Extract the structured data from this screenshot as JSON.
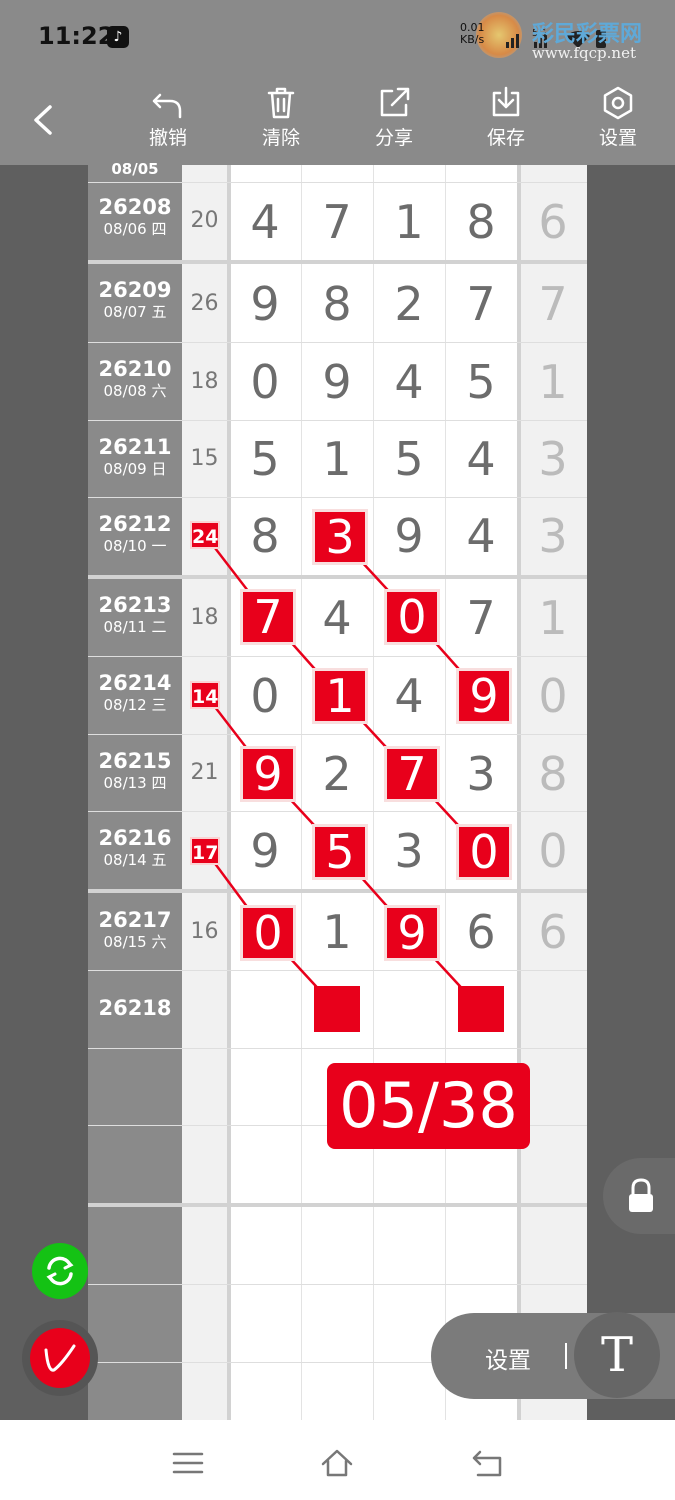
{
  "status": {
    "time": "11:22",
    "net_speed": "0.01",
    "net_unit": "KB/s",
    "sig1": "5G",
    "sig2": "5G"
  },
  "watermark": {
    "brand": "彩民彩票网",
    "url": "www.fqcp.net"
  },
  "toolbar": {
    "undo": "撤销",
    "clear": "清除",
    "share": "分享",
    "save": "保存",
    "settings": "设置"
  },
  "rows": [
    {
      "issue": "26208",
      "day": "08/06 四",
      "sum": "20",
      "digits": [
        "4",
        "7",
        "1",
        "8"
      ],
      "tail": "6"
    },
    {
      "issue": "26209",
      "day": "08/07 五",
      "sum": "26",
      "digits": [
        "9",
        "8",
        "2",
        "7"
      ],
      "tail": "7"
    },
    {
      "issue": "26210",
      "day": "08/08 六",
      "sum": "18",
      "digits": [
        "0",
        "9",
        "4",
        "5"
      ],
      "tail": "1"
    },
    {
      "issue": "26211",
      "day": "08/09 日",
      "sum": "15",
      "digits": [
        "5",
        "1",
        "5",
        "4"
      ],
      "tail": "3"
    },
    {
      "issue": "26212",
      "day": "08/10 一",
      "sum": "24",
      "digits": [
        "8",
        "3",
        "9",
        "4"
      ],
      "tail": "3"
    },
    {
      "issue": "26213",
      "day": "08/11 二",
      "sum": "18",
      "digits": [
        "7",
        "4",
        "0",
        "7"
      ],
      "tail": "1"
    },
    {
      "issue": "26214",
      "day": "08/12 三",
      "sum": "14",
      "digits": [
        "0",
        "1",
        "4",
        "9"
      ],
      "tail": "0"
    },
    {
      "issue": "26215",
      "day": "08/13 四",
      "sum": "21",
      "digits": [
        "9",
        "2",
        "7",
        "3"
      ],
      "tail": "8"
    },
    {
      "issue": "26216",
      "day": "08/14 五",
      "sum": "17",
      "digits": [
        "9",
        "5",
        "3",
        "0"
      ],
      "tail": "0"
    },
    {
      "issue": "26217",
      "day": "08/15 六",
      "sum": "16",
      "digits": [
        "0",
        "1",
        "9",
        "6"
      ],
      "tail": "6"
    }
  ],
  "next_issue": "26218",
  "score": "05/38",
  "panel": {
    "settings_label": "设置",
    "text_tool": "T"
  },
  "colors": {
    "accent_red": "#e8001b",
    "toolbar_gray": "#8a8a8a",
    "green": "#14c214"
  },
  "icons": [
    "back-arrow-icon",
    "undo-icon",
    "trash-icon",
    "share-icon",
    "download-icon",
    "settings-hex-icon",
    "lock-icon",
    "refresh-icon",
    "pen-icon",
    "menu-icon",
    "home-icon",
    "return-icon"
  ]
}
